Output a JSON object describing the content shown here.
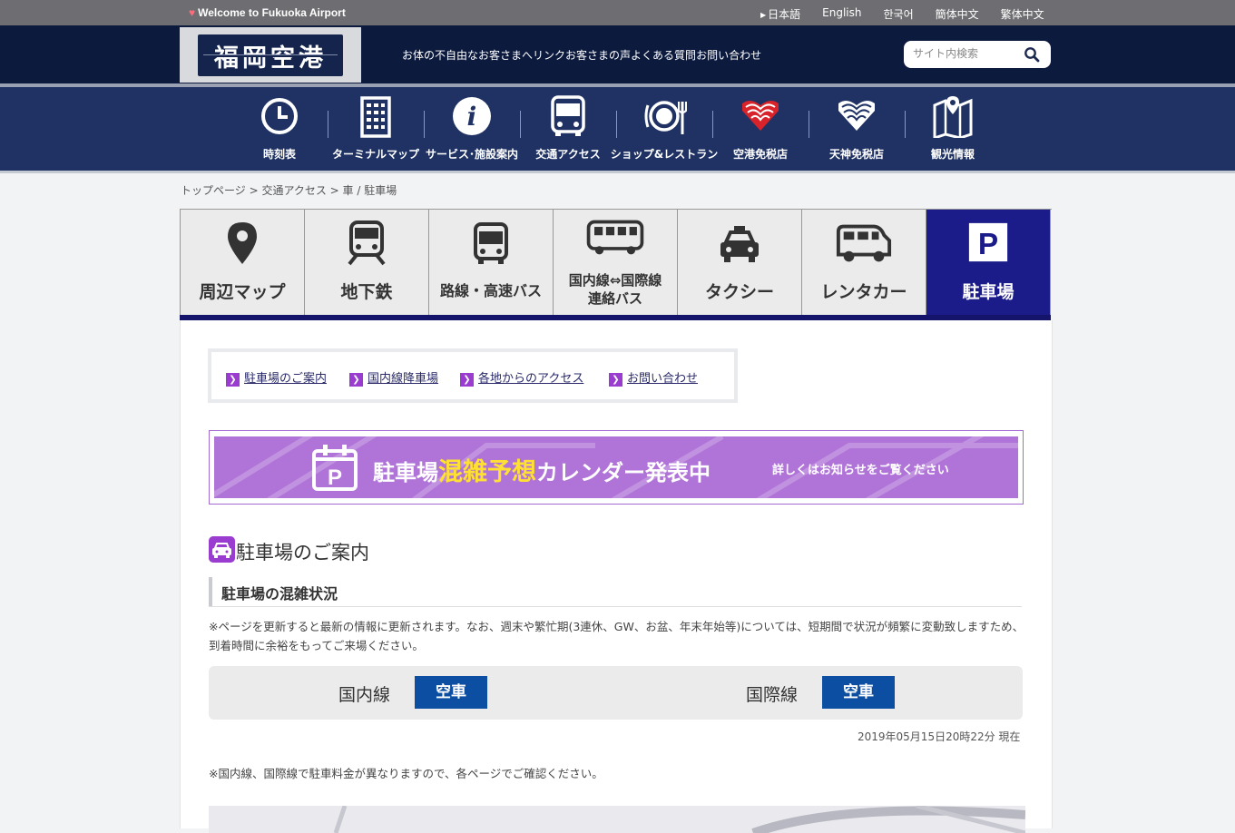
{
  "topbar": {
    "welcome": "Welcome to Fukuoka Airport",
    "languages": [
      "日本語",
      "English",
      "한국어",
      "簡体中文",
      "繁体中文"
    ]
  },
  "header": {
    "logo_text": "福岡空港",
    "links": [
      "お体の不自由なお客さまへ",
      "リンク",
      "お客さまの声",
      "よくある質問",
      "お問い合わせ"
    ],
    "search_placeholder": "サイト内検索"
  },
  "icon_nav": [
    {
      "label": "時刻表",
      "icon": "clock-icon"
    },
    {
      "label": "ターミナルマップ",
      "icon": "building-icon"
    },
    {
      "label": "サービス･施設案内",
      "icon": "info-icon"
    },
    {
      "label": "交通アクセス",
      "icon": "bus-icon"
    },
    {
      "label": "ショップ&レストラン",
      "icon": "dining-icon"
    },
    {
      "label": "空港免税店",
      "icon": "duty-free-airport-icon"
    },
    {
      "label": "天神免税店",
      "icon": "duty-free-tenjin-icon"
    },
    {
      "label": "観光情報",
      "icon": "map-pin-icon"
    }
  ],
  "breadcrumb": "トップページ > 交通アクセス > 車 / 駐車場",
  "tabs": [
    {
      "label": "周辺マップ",
      "icon": "location-pin-icon"
    },
    {
      "label": "地下鉄",
      "icon": "subway-icon"
    },
    {
      "label": "路線・高速バス",
      "icon": "bus-icon"
    },
    {
      "label_line1": "国内線⇔国際線",
      "label_line2": "連絡バス",
      "icon": "shuttle-bus-icon"
    },
    {
      "label": "タクシー",
      "icon": "taxi-icon"
    },
    {
      "label": "レンタカー",
      "icon": "rental-car-icon"
    },
    {
      "label": "駐車場",
      "icon": "parking-icon",
      "active": true
    }
  ],
  "subnav": [
    "駐車場のご案内",
    "国内線降車場",
    "各地からのアクセス",
    "お問い合わせ"
  ],
  "banner": {
    "prefix": "駐車場",
    "highlight": "混雑予想",
    "suffix": "カレンダー発表中",
    "sub": "詳しくはお知らせをご覧ください"
  },
  "section": {
    "title": "駐車場のご案内",
    "subheading": "駐車場の混雑状況",
    "note": "※ページを更新すると最新の情報に更新されます。なお、週末や繁忙期(3連休、GW、お盆、年末年始等)については、短期間で状況が頻繁に変動致しますため、到着時間に余裕をもってご来場ください。",
    "status": [
      {
        "terminal": "国内線",
        "value": "空車"
      },
      {
        "terminal": "国際線",
        "value": "空車"
      }
    ],
    "timestamp": "2019年05月15日20時22分 現在",
    "note2": "※国内線、国際線で駐車料金が異なりますので、各ページでご確認ください。"
  },
  "colors": {
    "header_bg": "#0c1a3e",
    "nav_bg": "#1f3263",
    "active_tab": "#1b1b8a",
    "accent_purple": "#9a3cd0",
    "status_badge": "#0b4ea2"
  }
}
